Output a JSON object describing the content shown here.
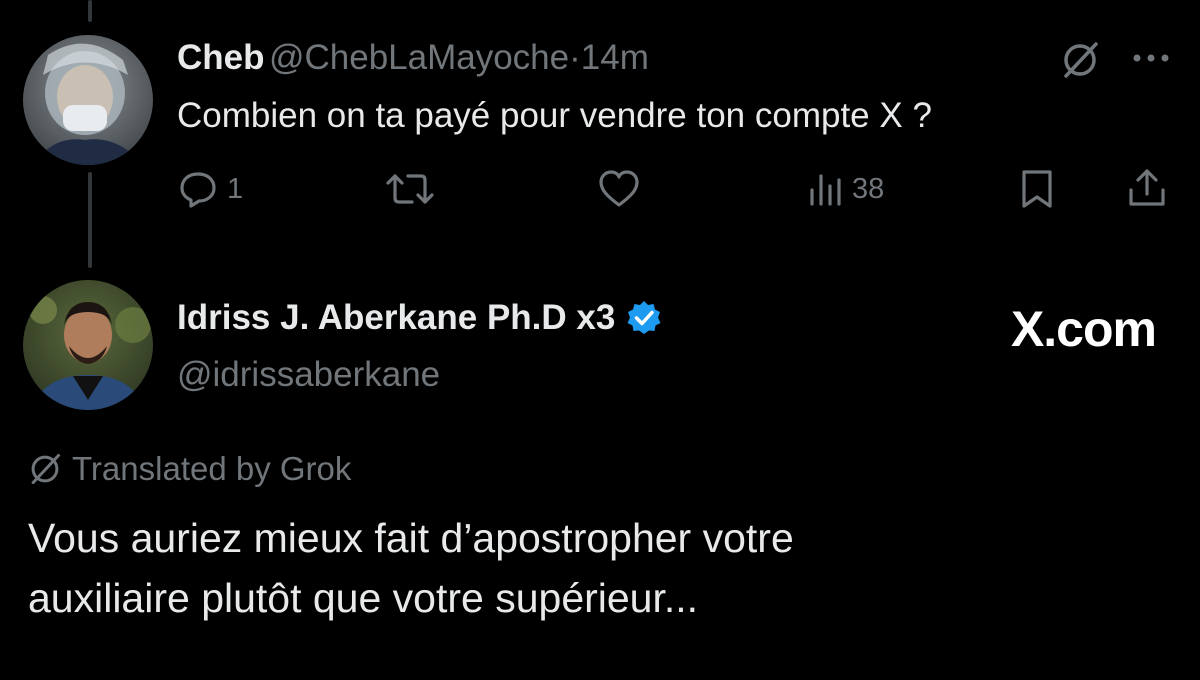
{
  "tweet1": {
    "author_name": "Cheb",
    "author_handle": "@ChebLaMayoche",
    "separator": "·",
    "time": "14m",
    "text": "Combien on ta payé pour vendre ton compte X ?",
    "actions": {
      "reply_count": "1",
      "retweet_count": "",
      "like_count": "",
      "views_count": "38"
    }
  },
  "tweet2": {
    "author_name": "Idriss J. Aberkane Ph.D x3",
    "author_handle": "@idrissaberkane",
    "verified": true,
    "watermark": "X.com",
    "translated_label": "Translated by Grok",
    "text_line1": "Vous auriez mieux fait d’apostropher votre",
    "text_line2": "auxiliaire plutôt que votre supérieur..."
  },
  "colors": {
    "background": "#000000",
    "primary_text": "#e7e9ea",
    "secondary_text": "#71767b",
    "verified_blue": "#1d9bf0",
    "thread_line": "#333639"
  },
  "icons": {
    "grok": "grok-icon",
    "more": "more-icon",
    "reply": "reply-icon",
    "retweet": "retweet-icon",
    "like": "like-icon",
    "views": "views-icon",
    "bookmark": "bookmark-icon",
    "share": "share-icon",
    "verified": "verified-badge-icon"
  }
}
